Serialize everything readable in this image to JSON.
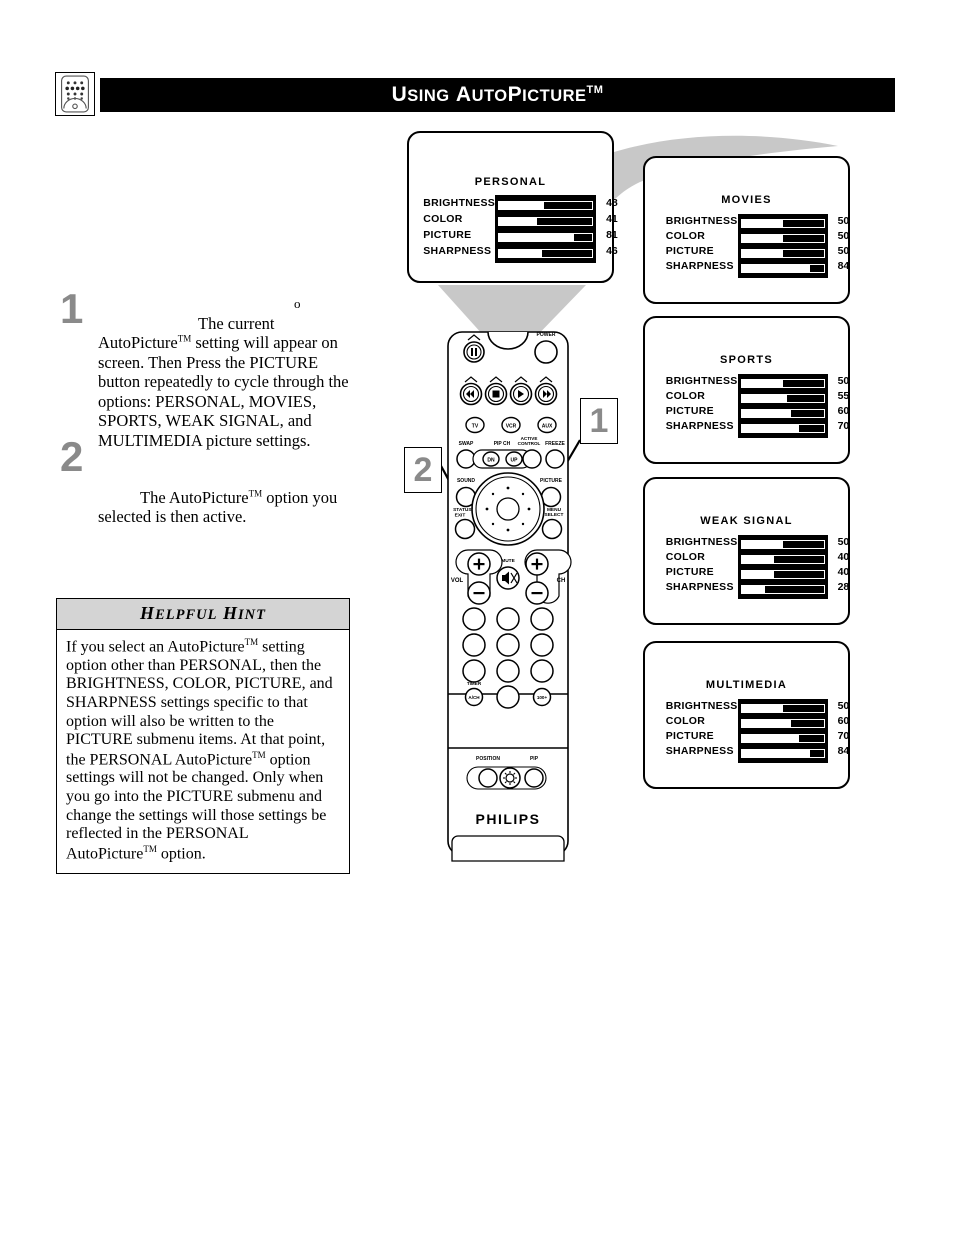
{
  "header": {
    "icon": "remote-control-icon",
    "title_parts": [
      {
        "t": "U",
        "size": "cap"
      },
      {
        "t": "SING",
        "size": "sc"
      },
      {
        "t": " A",
        "size": "cap"
      },
      {
        "t": "UTO",
        "size": "sc"
      },
      {
        "t": "P",
        "size": "cap"
      },
      {
        "t": "ICTURE",
        "size": "sc"
      },
      {
        "t": "TM",
        "size": "tm"
      }
    ],
    "title_plain": "Using AutoPicture™"
  },
  "steps": [
    {
      "number": "1",
      "stray_char": "o",
      "text": "The current AutoPicture™  setting will appear on screen. Then Press the PICTURE button repeatedly to cycle through the options: PERSONAL, MOVIES, SPORTS, WEAK SIGNAL, and MULTIMEDIA picture settings."
    },
    {
      "number": "2",
      "text": "The AutoPicture™ option you selected is then active."
    }
  ],
  "hint": {
    "title_parts": [
      {
        "t": "H",
        "size": "cap"
      },
      {
        "t": "ELPFUL",
        "size": "sc"
      },
      {
        "t": " H",
        "size": "cap"
      },
      {
        "t": "INT",
        "size": "sc"
      }
    ],
    "title_plain": "Helpful Hint",
    "text": "If you select an AutoPicture™ setting option other than PERSONAL, then the BRIGHTNESS, COLOR, PICTURE, and SHARPNESS settings specific to that option will also be written to the PICTURE submenu items. At that point, the PERSONAL AutoPicture™ option settings will not be changed. Only when you go into the PICTURE submenu and change the settings will those settings be reflected in the PERSONAL AutoPicture™ option."
  },
  "menu_rows": [
    "BRIGHTNESS",
    "COLOR",
    "PICTURE",
    "SHARPNESS"
  ],
  "panels": [
    {
      "id": "personal",
      "title": "PERSONAL",
      "values": [
        48,
        41,
        81,
        46
      ]
    },
    {
      "id": "movies",
      "title": "MOVIES",
      "values": [
        50,
        50,
        50,
        84
      ]
    },
    {
      "id": "sports",
      "title": "SPORTS",
      "values": [
        50,
        55,
        60,
        70
      ]
    },
    {
      "id": "weaksignal",
      "title": "WEAK  SIGNAL",
      "values": [
        50,
        40,
        40,
        28
      ]
    },
    {
      "id": "multimedia",
      "title": "MULTIMEDIA",
      "values": [
        50,
        60,
        70,
        84
      ]
    }
  ],
  "callouts": [
    {
      "label": "1",
      "target": "picture-button"
    },
    {
      "label": "2",
      "target": "status-exit-button"
    }
  ],
  "remote": {
    "brand": "PHILIPS",
    "labels": {
      "power": "POWER",
      "tv": "TV",
      "vcr": "VCR",
      "aux": "AUX",
      "swap": "SWAP",
      "pip_ch": "PIP CH",
      "pip_dn": "DN",
      "pip_up": "UP",
      "active_control_line1": "ACTIVE",
      "active_control_line2": "CONTROL",
      "freeze": "FREEZE",
      "sound": "SOUND",
      "picture": "PICTURE",
      "status_line1": "STATUS/",
      "status_line2": "EXIT",
      "menu_line1": "MENU",
      "menu_line2": "SELECT",
      "vol": "VOL",
      "ch": "CH",
      "mute": "MUTE",
      "timer": "TIMER",
      "a_ch": "A/CH",
      "hundred_plus": "100+",
      "position": "POSITION",
      "pip": "PIP"
    }
  },
  "colors": {
    "header_bg": "#000000",
    "header_fg": "#ffffff",
    "step_number": "#8a8a8a",
    "hint_header_bg": "#d4d4d4",
    "gray_art": "#c8c8c8",
    "bar_fill": "#ffffff",
    "bar_track": "#000000"
  }
}
